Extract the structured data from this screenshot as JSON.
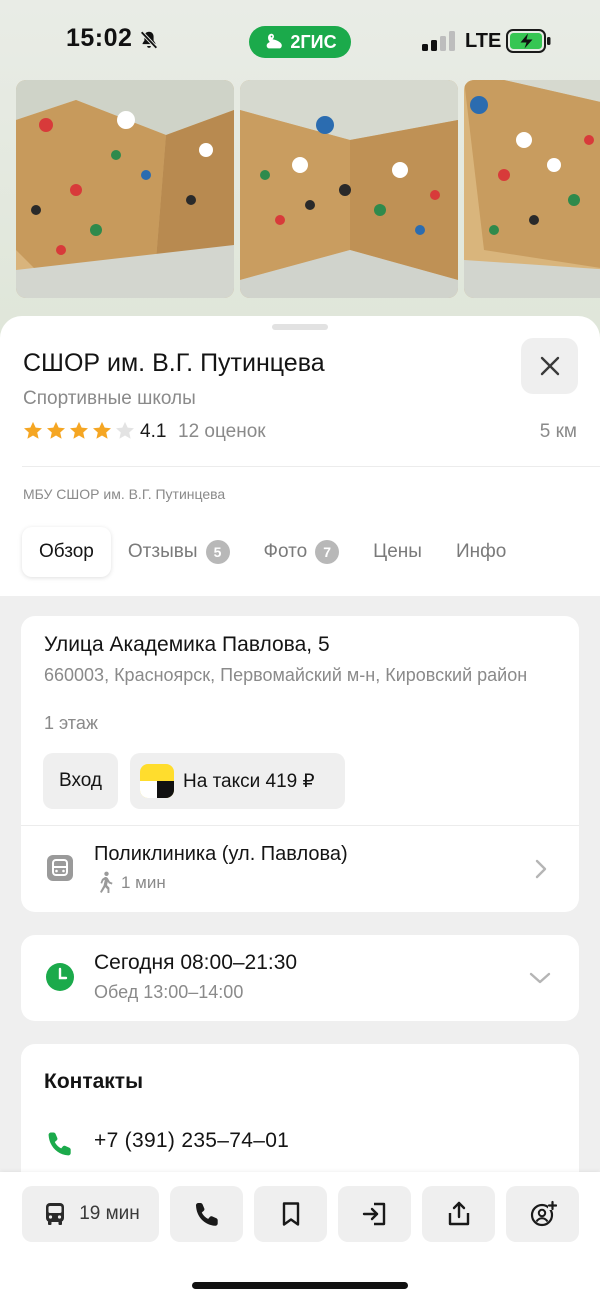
{
  "status_bar": {
    "time": "15:02",
    "brand": "2ГИС",
    "network": "LTE",
    "icons": [
      "bell-muted-icon",
      "signal-icon",
      "battery-charging-icon"
    ]
  },
  "photos": {
    "count_visible": 3
  },
  "place": {
    "title": "СШОР им. В.Г. Путинцева",
    "category": "Спортивные школы",
    "rating": "4.1",
    "rating_stars": 4.1,
    "rating_count": "12 оценок",
    "distance": "5 км",
    "org_name": "МБУ СШОР им. В.Г. Путинцева"
  },
  "tabs": [
    {
      "label": "Обзор",
      "active": true
    },
    {
      "label": "Отзывы",
      "badge": "5"
    },
    {
      "label": "Фото",
      "badge": "7"
    },
    {
      "label": "Цены"
    },
    {
      "label": "Инфо"
    }
  ],
  "address": {
    "street": "Улица Академика Павлова, 5",
    "details": "660003, Красноярск, Первомайский м-н, Кировский район",
    "floor": "1 этаж",
    "entrance_label": "Вход",
    "taxi_label": "На такси 419 ₽"
  },
  "transit": {
    "stop_name": "Поликлиника (ул. Павлова)",
    "walk_time": "1 мин"
  },
  "hours": {
    "today": "Сегодня 08:00–21:30",
    "lunch": "Обед 13:00–14:00"
  },
  "contacts": {
    "title": "Контакты",
    "phone": "+7 (391) 235–74–01"
  },
  "toolbar": {
    "route_time": "19 мин",
    "icons": [
      "bus-icon",
      "phone-icon",
      "bookmark-icon",
      "entrance-icon",
      "share-icon",
      "add-friend-icon"
    ]
  },
  "colors": {
    "brand_green": "#1baa4b",
    "star_yellow": "#f5a623",
    "text_secondary": "#8a8a8a"
  }
}
